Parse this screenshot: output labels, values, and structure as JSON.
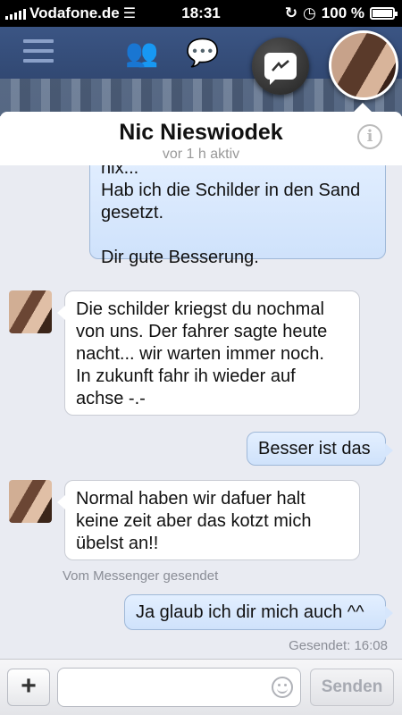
{
  "status_bar": {
    "carrier": "Vodafone.de",
    "time": "18:31",
    "battery": "100 %"
  },
  "chat": {
    "contact_name": "Nic Nieswiodek",
    "activity": "vor 1 h aktiv"
  },
  "messages": [
    {
      "direction": "out",
      "text": "nix...\nHab ich die Schilder in den Sand\ngesetzt.\n\nDir gute Besserung."
    },
    {
      "direction": "in",
      "text": "Die schilder kriegst du nochmal\nvon uns. Der fahrer sagte heute\nnacht... wir warten immer noch.\nIn zukunft fahr ih wieder auf\nachse -.-"
    },
    {
      "direction": "out",
      "text": "Besser ist das"
    },
    {
      "direction": "in",
      "text": "Normal haben wir dafuer halt\nkeine zeit aber das kotzt mich\nübelst an!!"
    },
    {
      "direction": "note",
      "text": "Vom Messenger gesendet"
    },
    {
      "direction": "out",
      "text": "Ja glaub ich dir mich auch ^^"
    },
    {
      "direction": "note",
      "text": "Gesendet: 16:08"
    }
  ],
  "composer": {
    "input_value": "",
    "send_label": "Senden"
  }
}
